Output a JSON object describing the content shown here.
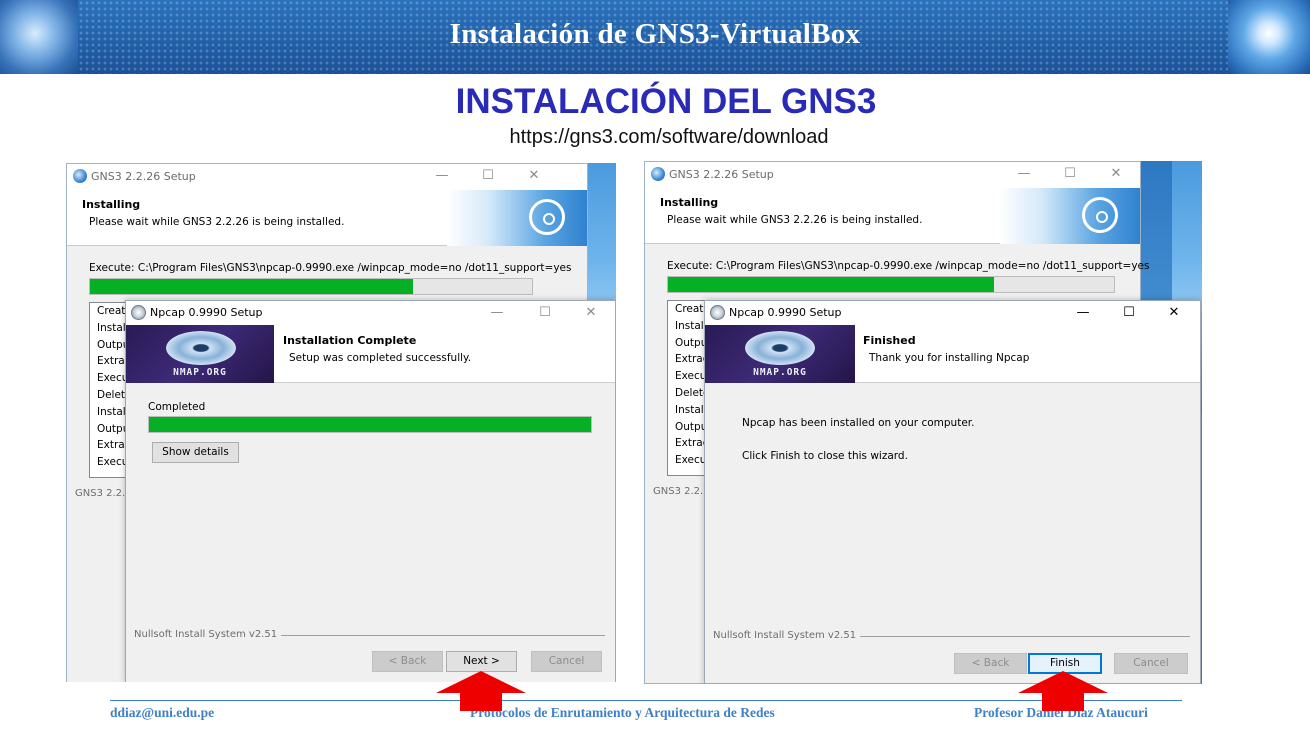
{
  "banner": {
    "title": "Instalación de GNS3-VirtualBox"
  },
  "slide": {
    "title": "INSTALACIÓN DEL GNS3",
    "url": "https://gns3.com/software/download"
  },
  "left_screenshot": {
    "gns_window": {
      "title": "GNS3 2.2.26 Setup",
      "header_title": "Installing",
      "header_subtitle": "Please wait while GNS3 2.2.26 is being installed.",
      "exec_line": "Execute: C:\\Program Files\\GNS3\\npcap-0.9990.exe /winpcap_mode=no /dot11_support=yes",
      "progress_fraction": 0.73,
      "log_items": [
        "Create",
        "Install",
        "Output",
        "Extrac",
        "Execu",
        "Delete",
        "Install",
        "Output",
        "Extrac",
        "Execu"
      ],
      "footer": "GNS3 2.2.2"
    },
    "npcap_window": {
      "title": "Npcap 0.9990 Setup",
      "logo_text": "NMAP.ORG",
      "header_title": "Installation Complete",
      "header_subtitle": "Setup was completed successfully.",
      "status_label": "Completed",
      "progress_fraction": 1.0,
      "show_details_label": "Show details",
      "footer": "Nullsoft Install System v2.51",
      "back_label": "< Back",
      "next_label": "Next >",
      "cancel_label": "Cancel"
    }
  },
  "right_screenshot": {
    "gns_window": {
      "title": "GNS3 2.2.26 Setup",
      "header_title": "Installing",
      "header_subtitle": "Please wait while GNS3 2.2.26 is being installed.",
      "exec_line": "Execute: C:\\Program Files\\GNS3\\npcap-0.9990.exe /winpcap_mode=no /dot11_support=yes",
      "progress_fraction": 0.73,
      "log_items": [
        "Create",
        "Install",
        "Output",
        "Extrac",
        "Execu",
        "Delete",
        "Install",
        "Output",
        "Extrac",
        "Execu"
      ],
      "footer": "GNS3 2.2.2"
    },
    "npcap_window": {
      "title": "Npcap 0.9990 Setup",
      "logo_text": "NMAP.ORG",
      "header_title": "Finished",
      "header_subtitle": "Thank you for installing Npcap",
      "body_line_1": "Npcap has been installed on your computer.",
      "body_line_2": "Click Finish to close this wizard.",
      "footer": "Nullsoft Install System v2.51",
      "back_label": "< Back",
      "finish_label": "Finish",
      "cancel_label": "Cancel"
    }
  },
  "footer": {
    "email": "ddiaz@uni.edu.pe",
    "course": "Protocolos de Enrutamiento y Arquitectura de Redes",
    "professor": "Profesor Daniel Díaz Ataucuri"
  },
  "colors": {
    "banner_blue": "#1d5fa8",
    "title_blue": "#2a2ab8",
    "progress_green": "#06b025",
    "arrow_red": "#ee0000",
    "footer_blue": "#4080c8"
  }
}
